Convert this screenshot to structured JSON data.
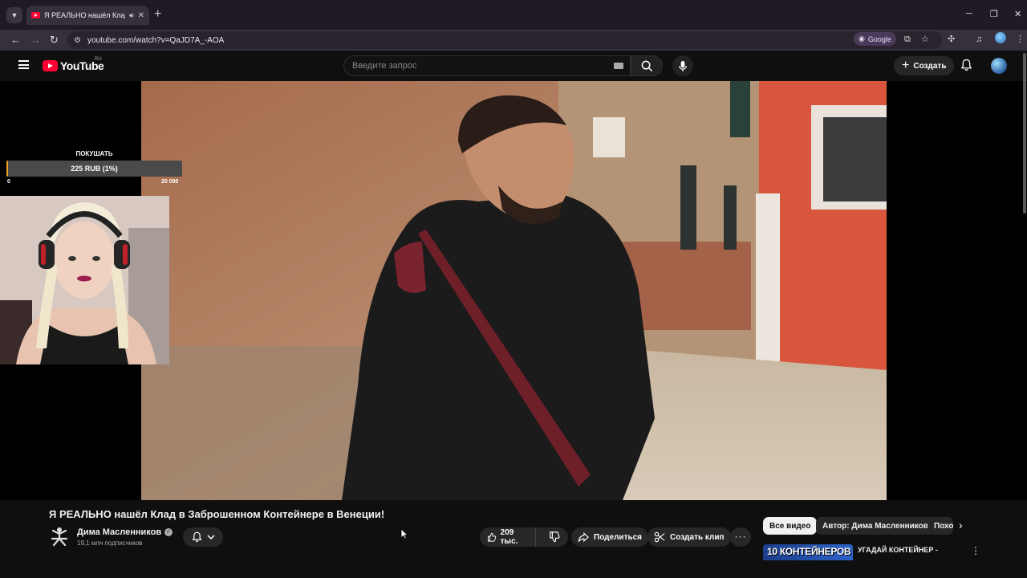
{
  "browser": {
    "tab_title": "Я РЕАЛЬНО нашёл Клад в Заброшенном Контейнере в Венеции",
    "url": "youtube.com/watch?v=QaJD7A_-AOA",
    "google_pill": "Google"
  },
  "youtube": {
    "logo_text": "YouTube",
    "region": "RU",
    "search_placeholder": "Введите запрос",
    "create_label": "Создать"
  },
  "overlay": {
    "goal_title": "ПОКУШАТЬ",
    "goal_text": "225 RUB (1%)",
    "goal_progress": 0.01,
    "goal_min": "0",
    "goal_max": "20 000"
  },
  "video": {
    "title": "Я РЕАЛЬНО нашёл Клад в Заброшенном Контейнере в Венеции!",
    "channel_name": "Дима Масленников",
    "subscribers": "19,1 млн подписчиков",
    "likes": "209 тыс.",
    "share_label": "Поделиться",
    "clip_label": "Создать клип"
  },
  "chips": [
    {
      "label": "Все видео",
      "active": true
    },
    {
      "label": "Автор: Дима Масленников",
      "active": false
    },
    {
      "label": "Похожие",
      "active": false
    }
  ],
  "recommendation": {
    "thumb_text": "10 КОНТЕЙНЕРОВ",
    "title": "УГАДАЙ КОНТЕЙНЕР -"
  },
  "colors": {
    "youtube_red": "#ff0033",
    "goal_fill": "#f0a020",
    "bg": "#0f0f0f"
  }
}
